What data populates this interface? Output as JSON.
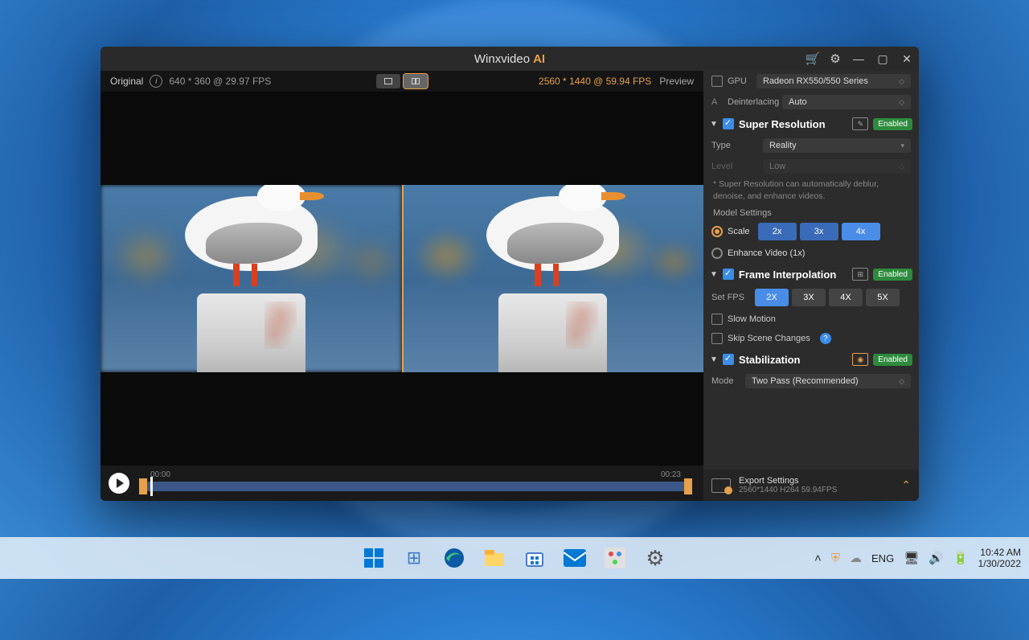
{
  "app": {
    "title": "Winxvideo",
    "title_accent": "AI"
  },
  "preview": {
    "original_label": "Original",
    "original_res": "640 * 360 @ 29.97 FPS",
    "output_res": "2560 * 1440 @ 59.94 FPS",
    "preview_label": "Preview",
    "time_start": "00:00",
    "time_end": "00:23"
  },
  "hw": {
    "gpu_label": "GPU",
    "gpu_value": "Radeon RX550/550 Series",
    "deint_label": "Deinterlacing",
    "deint_value": "Auto"
  },
  "sr": {
    "title": "Super Resolution",
    "badge": "Enabled",
    "type_label": "Type",
    "type_value": "Reality",
    "level_label": "Level",
    "level_value": "Low",
    "note": "* Super Resolution can automatically deblur, denoise, and enhance videos.",
    "model_label": "Model Settings",
    "scale_label": "Scale",
    "scales": [
      "2x",
      "3x",
      "4x"
    ],
    "scale_selected": "4x",
    "enhance_label": "Enhance Video (1x)"
  },
  "fi": {
    "title": "Frame Interpolation",
    "badge": "Enabled",
    "setfps_label": "Set FPS",
    "fps_options": [
      "2X",
      "3X",
      "4X",
      "5X"
    ],
    "fps_selected": "2X",
    "slowmo_label": "Slow Motion",
    "skip_label": "Skip Scene Changes"
  },
  "stab": {
    "title": "Stabilization",
    "badge": "Enabled",
    "mode_label": "Mode",
    "mode_value": "Two Pass (Recommended)"
  },
  "export": {
    "title": "Export Settings",
    "sub": "2560*1440  H264  59.94FPS"
  },
  "tray": {
    "lang": "ENG",
    "time": "10:42 AM",
    "date": "1/30/2022"
  }
}
